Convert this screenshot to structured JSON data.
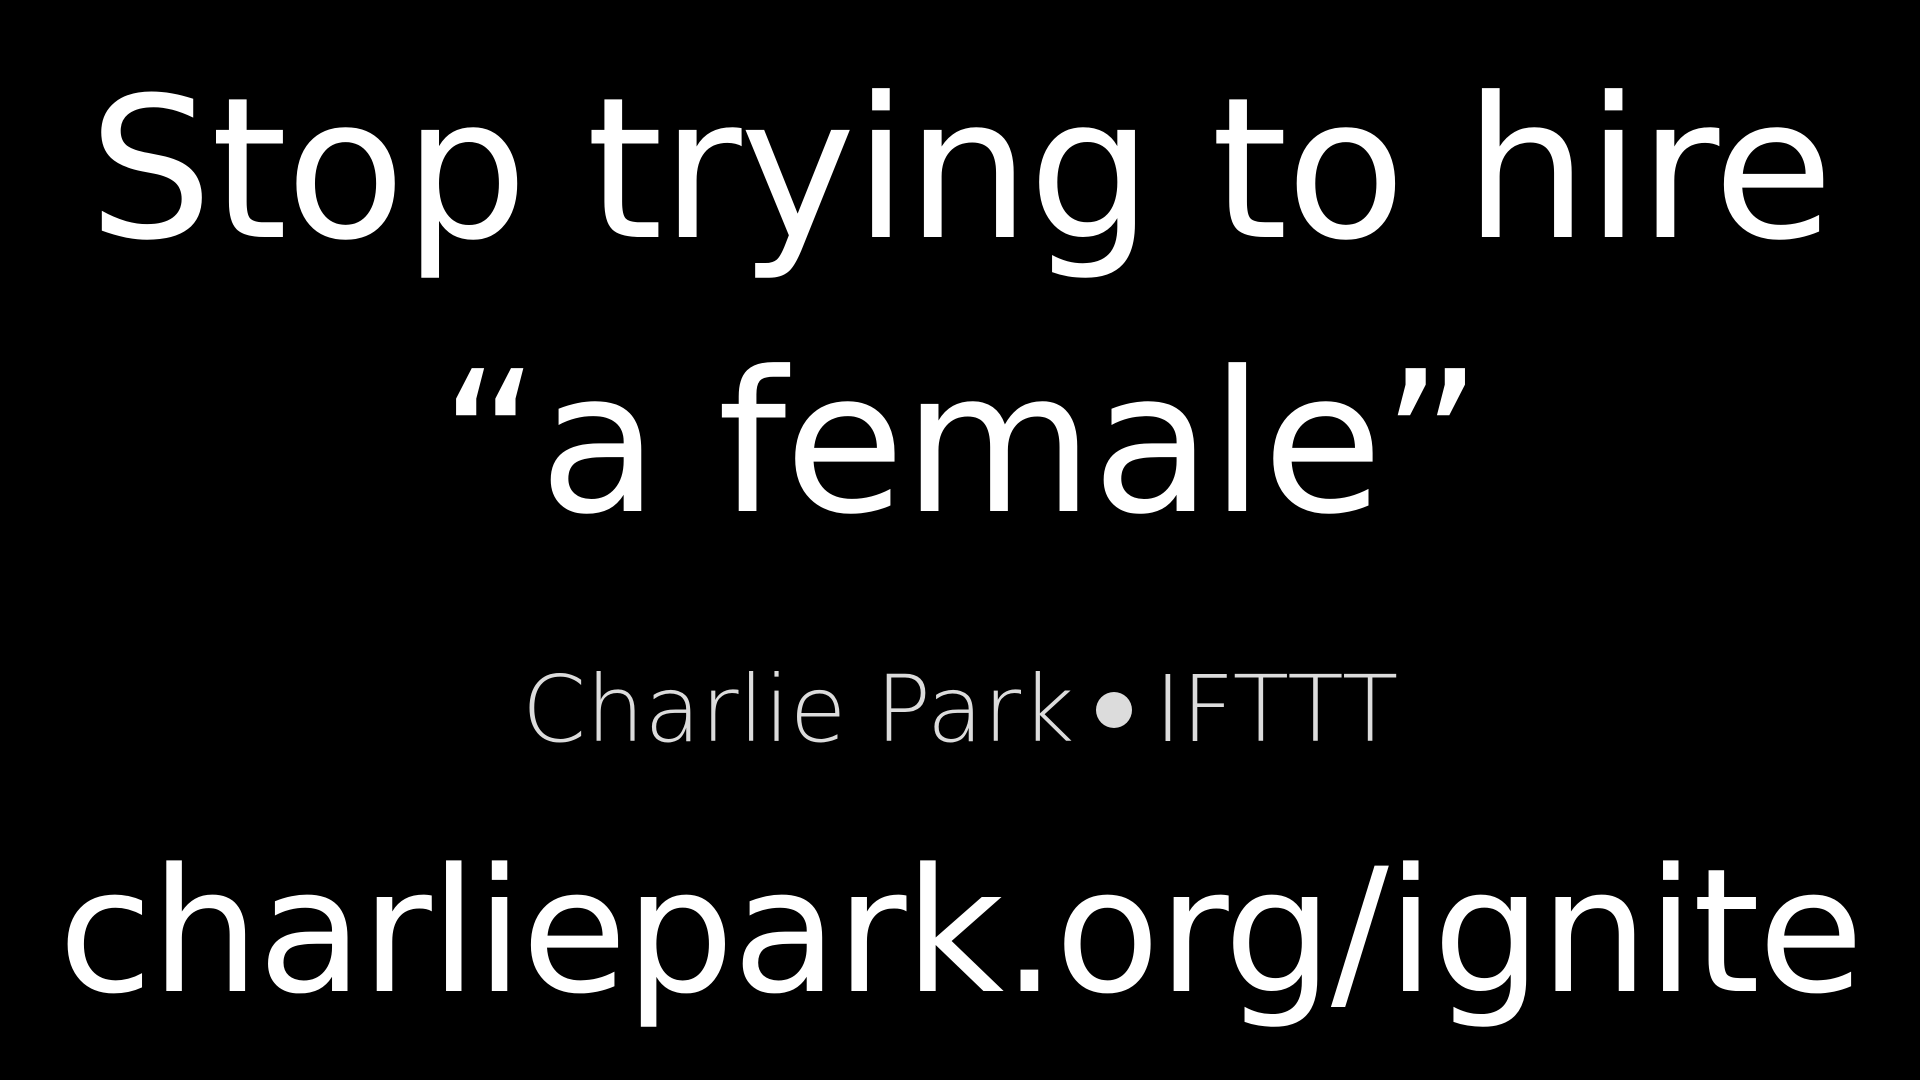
{
  "slide": {
    "title_line_1": "Stop trying to hire",
    "title_line_2": "“a female”",
    "byline_name": "Charlie Park",
    "byline_org": "IFTTT",
    "url": "charliepark.org/ignite"
  },
  "colors": {
    "background": "#000000",
    "text": "#ffffff",
    "byline_text": "#dcdcdc"
  }
}
